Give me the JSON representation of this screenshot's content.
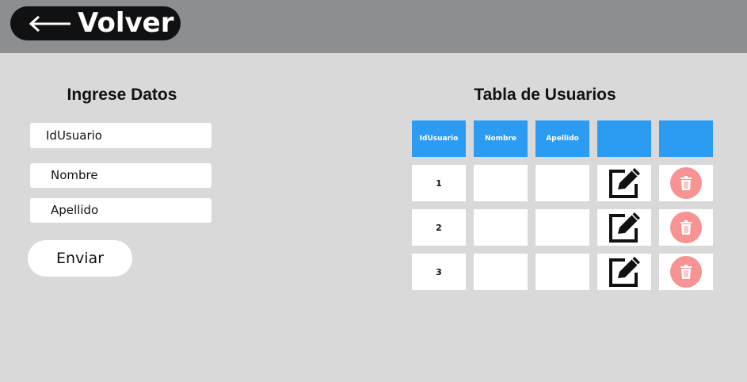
{
  "header": {
    "back_label": "Volver",
    "back_icon": "arrow-left-icon",
    "bg_color": "#8c8e90"
  },
  "form": {
    "title": "Ingrese Datos",
    "fields": {
      "id": "IdUsuario",
      "nombre": "Nombre",
      "apellido": "Apellido"
    },
    "submit_label": "Enviar"
  },
  "table": {
    "title": "Tabla de Usuarios",
    "headers": [
      "IdUsuario",
      "Nombre",
      "Apellido",
      "",
      ""
    ],
    "header_color": "#2b9cf2",
    "rows": [
      {
        "id": "1",
        "nombre": "",
        "apellido": ""
      },
      {
        "id": "2",
        "nombre": "",
        "apellido": ""
      },
      {
        "id": "3",
        "nombre": "",
        "apellido": ""
      }
    ],
    "edit_icon": "edit-icon",
    "delete_icon": "trash-icon",
    "delete_color": "#f79393"
  }
}
